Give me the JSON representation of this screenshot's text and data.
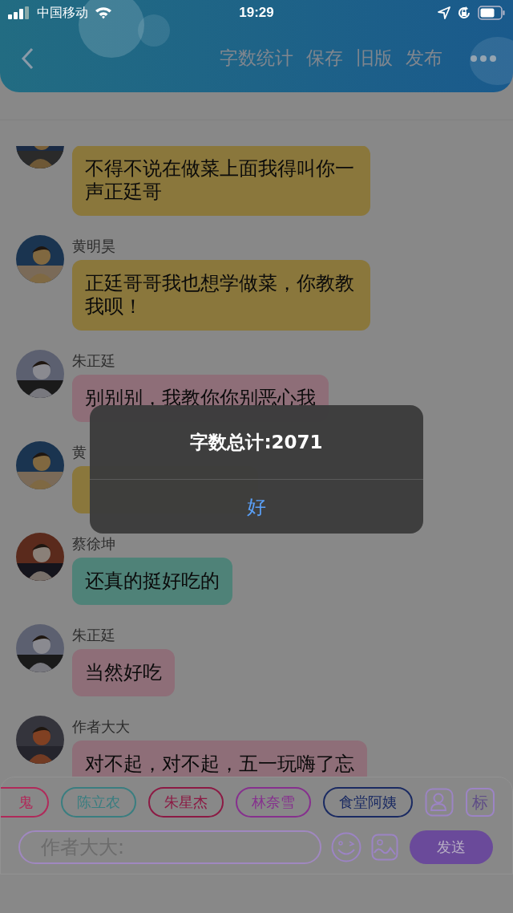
{
  "status_bar": {
    "carrier": "中国移动",
    "time": "19:29"
  },
  "header": {
    "actions": [
      "字数统计",
      "保存",
      "旧版",
      "发布"
    ]
  },
  "messages": [
    {
      "text": "不得不说在做菜上面我得叫你一声正廷哥",
      "color": "#8a773c"
    },
    {
      "name": "黄明昊",
      "text": "正廷哥哥我也想学做菜，你教教我呗！",
      "color": "#8a773c"
    },
    {
      "name": "朱正廷",
      "text": "别别别，我教你你别恶心我",
      "color": "#8e6e78"
    },
    {
      "name": "黄",
      "color": "#8a773c"
    },
    {
      "name": "蔡徐坤",
      "text": "还真的挺好吃的",
      "color": "#4f8278"
    },
    {
      "name": "朱正廷",
      "text": "当然好吃",
      "color": "#8e6e78"
    },
    {
      "name": "作者大大",
      "text": "对不起，对不起，五一玩嗨了忘",
      "color": "#8e6e78"
    }
  ],
  "roles": [
    {
      "label": "鬼",
      "color": "#b02a5a"
    },
    {
      "label": "陈立农",
      "color": "#3a7e80"
    },
    {
      "label": "朱星杰",
      "color": "#8c1a44"
    },
    {
      "label": "林奈雪",
      "color": "#86308e"
    },
    {
      "label": "食堂阿姨",
      "color": "#1a2a62"
    }
  ],
  "mark_button": "标",
  "input": {
    "placeholder": "作者大大:"
  },
  "send_button": "发送",
  "dialog": {
    "message": "字数总计:2071",
    "button": "好"
  }
}
